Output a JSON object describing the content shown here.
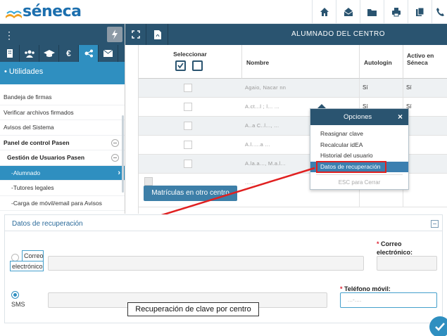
{
  "app": {
    "logo_text": "séneca",
    "brand_color": "#1c6fae"
  },
  "top_icons": [
    "home-icon",
    "mail-open-icon",
    "folder-icon",
    "print-icon",
    "copy-icon",
    "phone-icon"
  ],
  "sidebar": {
    "tabs": [
      "building-icon",
      "users-icon",
      "graduation-cap-icon",
      "euro-icon",
      "share-nodes-icon",
      "envelope-icon"
    ],
    "section_label": "• Utilidades",
    "items": [
      {
        "label": "Bandeja de firmas"
      },
      {
        "label": "Verificar archivos firmados"
      },
      {
        "label": "Avisos del Sistema"
      },
      {
        "label": "Panel de control Pasen"
      },
      {
        "label": "Gestión de Usuarios Pasen"
      },
      {
        "label": "-Alumnado"
      },
      {
        "label": "-Tutores legales"
      },
      {
        "label": "-Carga de móvil/email para Avisos"
      }
    ]
  },
  "main": {
    "title": "ALUMNADO DEL CENTRO",
    "table": {
      "headers": {
        "select": "Seleccionar",
        "name": "Nombre",
        "autologin": "Autologin",
        "active": "Activo en Séneca"
      },
      "rows": [
        {
          "name": "Agaio, Nacar nn",
          "autologin": "Sí",
          "active": "Sí"
        },
        {
          "name": "A.ct...l ; l... ...",
          "autologin": "Sí",
          "active": "Sí"
        },
        {
          "name": "A..a C..l..., ...",
          "autologin": "",
          "active": ""
        },
        {
          "name": "A.l.....a ...",
          "autologin": "",
          "active": ""
        },
        {
          "name": "A.la.a..., M.a.l...",
          "autologin": "",
          "active": ""
        },
        {
          "name": "......",
          "autologin": "",
          "active": ""
        }
      ]
    },
    "matriculas_button": "Matrículas en otro centro"
  },
  "popup": {
    "title": "Opciones",
    "close": "×",
    "items": [
      "Reasignar clave",
      "Recalcular idEA",
      "Historial del usuario",
      "Datos de recuperación"
    ],
    "selected": "Datos de recuperación",
    "esc": "ESC para Cerrar"
  },
  "recovery": {
    "title": "Datos de recuperación",
    "option_email_line1": "Correo",
    "option_email_line2": "electrónico",
    "option_sms": "SMS",
    "email_label_line1": "Correo",
    "email_label_line2": "electrónico:",
    "phone_label": "Teléfono móvil:",
    "phone_value": "...-....",
    "required_mark": "*",
    "selected_option": "SMS"
  },
  "tooltip": "Recuperación de clave por centro",
  "colors": {
    "navy": "#2a5470",
    "accent": "#2f8fc0",
    "annotation_red": "#e02020"
  }
}
